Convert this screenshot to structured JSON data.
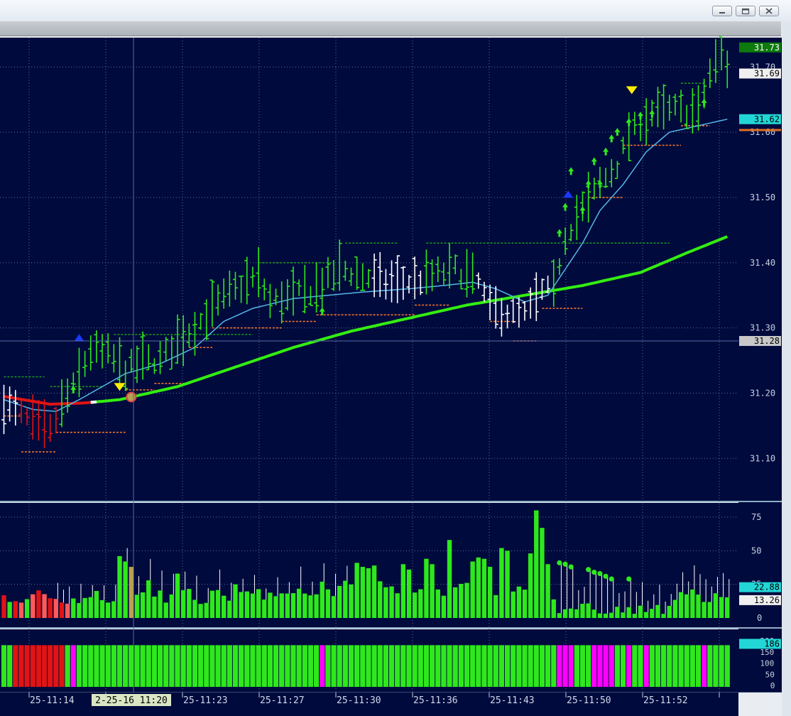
{
  "window": {
    "buttons": [
      {
        "name": "minimize-button",
        "icon": "minimize-icon"
      },
      {
        "name": "restore-button",
        "icon": "restore-icon"
      },
      {
        "name": "close-button",
        "icon": "close-icon"
      }
    ]
  },
  "colors": {
    "background": "#000a3d",
    "up_bar": "#2ee81c",
    "neutral_bar": "#ffffff",
    "down_bar": "#e01414",
    "slow_ma": "#33ee11",
    "fast_ma": "#56b6e8",
    "support_line": "#ff7a2a",
    "resistance_line": "#1e9a1a",
    "magenta": "#ff00ff",
    "grid": "#7f86aa"
  },
  "chart_data": [
    {
      "type": "bar",
      "panel": "price",
      "ylim": [
        31.035,
        31.745
      ],
      "y_ticks": [
        "31.10",
        "31.20",
        "31.30",
        "31.40",
        "31.50",
        "31.60",
        "31.70"
      ],
      "price_markers": [
        {
          "label": "31.73",
          "value": 31.73,
          "bg": "#0d7a0d",
          "fg": "#ffffff"
        },
        {
          "label": "31.69",
          "value": 31.69,
          "bg": "#f0f0f0",
          "fg": "#000000"
        },
        {
          "label": "31.62",
          "value": 31.62,
          "bg": "#22d6d6",
          "fg": "#000000"
        },
        {
          "label": "31.28",
          "value": 31.28,
          "bg": "#c8c8c8",
          "fg": "#000000"
        }
      ],
      "bars_count": 126,
      "anchors": [
        [
          0,
          31.185
        ],
        [
          4,
          31.16
        ],
        [
          8,
          31.14
        ],
        [
          10,
          31.18
        ],
        [
          12,
          31.21
        ],
        [
          15,
          31.265
        ],
        [
          18,
          31.26
        ],
        [
          21,
          31.235
        ],
        [
          24,
          31.25
        ],
        [
          27,
          31.25
        ],
        [
          30,
          31.28
        ],
        [
          33,
          31.3
        ],
        [
          36,
          31.33
        ],
        [
          40,
          31.36
        ],
        [
          44,
          31.38
        ],
        [
          46,
          31.34
        ],
        [
          50,
          31.35
        ],
        [
          54,
          31.36
        ],
        [
          58,
          31.39
        ],
        [
          62,
          31.38
        ],
        [
          66,
          31.37
        ],
        [
          70,
          31.37
        ],
        [
          74,
          31.38
        ],
        [
          78,
          31.39
        ],
        [
          82,
          31.37
        ],
        [
          84,
          31.33
        ],
        [
          88,
          31.32
        ],
        [
          90,
          31.32
        ],
        [
          93,
          31.355
        ],
        [
          95,
          31.36
        ],
        [
          97,
          31.44
        ],
        [
          99,
          31.47
        ],
        [
          103,
          31.52
        ],
        [
          106,
          31.55
        ],
        [
          108,
          31.595
        ],
        [
          112,
          31.63
        ],
        [
          116,
          31.635
        ],
        [
          120,
          31.63
        ],
        [
          122,
          31.69
        ],
        [
          124,
          31.72
        ],
        [
          125,
          31.7
        ]
      ],
      "slow_ma_anchors": [
        [
          0,
          31.195
        ],
        [
          8,
          31.183
        ],
        [
          14,
          31.185
        ],
        [
          20,
          31.19
        ],
        [
          30,
          31.21
        ],
        [
          40,
          31.24
        ],
        [
          50,
          31.27
        ],
        [
          60,
          31.295
        ],
        [
          70,
          31.315
        ],
        [
          80,
          31.335
        ],
        [
          90,
          31.35
        ],
        [
          100,
          31.365
        ],
        [
          110,
          31.385
        ],
        [
          118,
          31.415
        ],
        [
          125,
          31.44
        ]
      ],
      "fast_ma_anchors": [
        [
          0,
          31.19
        ],
        [
          5,
          31.175
        ],
        [
          9,
          31.172
        ],
        [
          13,
          31.19
        ],
        [
          17,
          31.21
        ],
        [
          21,
          31.23
        ],
        [
          27,
          31.245
        ],
        [
          33,
          31.27
        ],
        [
          38,
          31.31
        ],
        [
          43,
          31.33
        ],
        [
          50,
          31.345
        ],
        [
          56,
          31.35
        ],
        [
          62,
          31.355
        ],
        [
          70,
          31.36
        ],
        [
          76,
          31.365
        ],
        [
          81,
          31.37
        ],
        [
          85,
          31.36
        ],
        [
          90,
          31.34
        ],
        [
          94,
          31.35
        ],
        [
          97,
          31.39
        ],
        [
          100,
          31.43
        ],
        [
          103,
          31.48
        ],
        [
          107,
          31.52
        ],
        [
          111,
          31.57
        ],
        [
          115,
          31.6
        ],
        [
          120,
          31.61
        ],
        [
          125,
          31.62
        ]
      ]
    },
    {
      "type": "bar",
      "panel": "volume",
      "ylim": [
        -5,
        83
      ],
      "y_ticks": [
        "0",
        "25",
        "50",
        "75"
      ],
      "value_markers": [
        {
          "label": "22.88",
          "value": 22.88,
          "bg": "#22d6d6",
          "fg": "#000000"
        },
        {
          "label": "13.26",
          "value": 13.26,
          "bg": "#f0f0f0",
          "fg": "#000000"
        }
      ],
      "spikes": [
        [
          20,
          46
        ],
        [
          21,
          42
        ],
        [
          22,
          38
        ],
        [
          25,
          28
        ],
        [
          30,
          33
        ],
        [
          40,
          25
        ],
        [
          55,
          27
        ],
        [
          61,
          41
        ],
        [
          62,
          38
        ],
        [
          63,
          37
        ],
        [
          64,
          39
        ],
        [
          69,
          40
        ],
        [
          70,
          36
        ],
        [
          73,
          44
        ],
        [
          74,
          40
        ],
        [
          77,
          58
        ],
        [
          81,
          42
        ],
        [
          82,
          45
        ],
        [
          83,
          44
        ],
        [
          84,
          38
        ],
        [
          86,
          52
        ],
        [
          87,
          50
        ],
        [
          91,
          48
        ],
        [
          92,
          80
        ],
        [
          93,
          67
        ],
        [
          94,
          40
        ]
      ],
      "dots": [
        [
          96,
          41
        ],
        [
          97,
          40
        ],
        [
          98,
          38
        ],
        [
          101,
          36
        ],
        [
          102,
          34
        ],
        [
          103,
          33
        ],
        [
          104,
          31
        ],
        [
          105,
          29
        ],
        [
          108,
          29
        ]
      ]
    },
    {
      "type": "bar",
      "panel": "histogram",
      "ylim": [
        0,
        200
      ],
      "y_ticks": [
        "0",
        "50",
        "100",
        "150",
        "200"
      ],
      "value_markers": [
        {
          "label": "186",
          "value": 186,
          "bg": "#22d6d6",
          "fg": "#000000"
        }
      ]
    }
  ],
  "x_labels": [
    "25-11:14",
    "25-11:23",
    "25-11:27",
    "25-11:30",
    "25-11:36",
    "25-11:43",
    "25-11:50",
    "25-11:52"
  ],
  "crosshair_time": "2-25-16 11:20"
}
